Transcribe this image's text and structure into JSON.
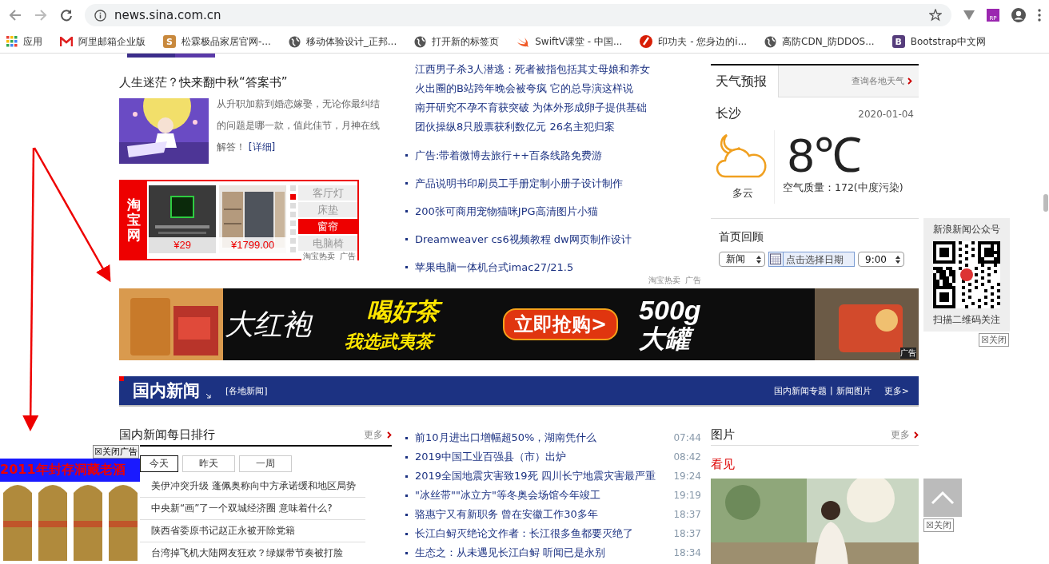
{
  "browser": {
    "url": "news.sina.com.cn",
    "extension_badge": "RP",
    "bookmarks": [
      {
        "label": "应用",
        "kind": "apps"
      },
      {
        "label": "阿里邮箱企业版",
        "kind": "mail"
      },
      {
        "label": "松霖极品家居官网-...",
        "kind": "letter",
        "glyph": "S"
      },
      {
        "label": "移动体验设计_正邦...",
        "kind": "globe"
      },
      {
        "label": "打开新的标签页",
        "kind": "globe"
      },
      {
        "label": "SwiftV课堂 - 中国...",
        "kind": "swift"
      },
      {
        "label": "印功夫 - 您身边的i...",
        "kind": "brush"
      },
      {
        "label": "高防CDN_防DDOS...",
        "kind": "globe"
      },
      {
        "label": "Bootstrap中文网",
        "kind": "letter",
        "glyph": "B"
      }
    ]
  },
  "feature": {
    "title": "人生迷茫？快来翻中秋“答案书”",
    "summary": "从升职加薪到婚恋嫁娶，无论你最纠结的问题是哪一款，值此佳节，月神在线解答！",
    "link": "[详细]"
  },
  "taobao_ad": {
    "logo": "淘宝网",
    "products": [
      {
        "kind": "course",
        "price": "¥29"
      },
      {
        "kind": "wardrobe",
        "price": "¥1799.00"
      }
    ],
    "dots": [
      {
        "selected": false
      },
      {
        "selected": true
      },
      {
        "selected": false
      },
      {
        "selected": false
      },
      {
        "selected": false
      },
      {
        "selected": false
      },
      {
        "selected": false
      },
      {
        "selected": false
      }
    ],
    "categories": [
      {
        "label": "客厅灯",
        "selected": false
      },
      {
        "label": "床垫",
        "selected": false
      },
      {
        "label": "窗帘",
        "selected": true
      },
      {
        "label": "电脑椅",
        "selected": false
      }
    ],
    "source": "淘宝热卖",
    "ad_tag": "广告"
  },
  "headlines": [
    "江西男子杀3人潜逃：死者被指包括其丈母娘和养女",
    "火出圈的B站跨年晚会被夸疯 它的总导演这样说",
    "南开研究不孕不育获突破 为体外形成卵子提供基础",
    "团伙操纵8只股票获利数亿元 26名主犯归案"
  ],
  "promo_links": [
    "广告:带着微博去旅行++百条线路免费游",
    "产品说明书印刷员工手册定制小册子设计制作",
    "200张可商用宠物猫咪JPG高清图片小猫",
    "Dreamweaver cs6视频教程 dw网页制作设计",
    "苹果电脑一体机台式imac27/21.5"
  ],
  "promo_source": "淘宝热卖",
  "promo_ad_tag": "广告",
  "weather": {
    "tab": "天气预报",
    "link": "查询各地天气",
    "city": "长沙",
    "date": "2020-01-04",
    "temperature": "8℃",
    "condition": "多云",
    "air_quality": "空气质量：172(中度污染)"
  },
  "review": {
    "title": "首页回顾",
    "channel": "新闻",
    "date_placeholder": "点击选择日期",
    "time": "9:00"
  },
  "banner": {
    "kind": "picture",
    "headline": "大红袍",
    "slogan_1": "喝好茶",
    "slogan_2": "我选武夷茶",
    "button": "立即抢购>",
    "weight": "500g",
    "size": "大罐",
    "ad_tag": "广告"
  },
  "section": {
    "title": "国内新闻",
    "sublink": "[各地新闻]",
    "links": [
      "国内新闻专题",
      "新闻图片"
    ],
    "separator": "|",
    "more": "更多>"
  },
  "ranking": {
    "title": "国内新闻每日排行",
    "more": "更多",
    "tabs": [
      {
        "label": "今天",
        "selected": true
      },
      {
        "label": "昨天",
        "selected": false
      },
      {
        "label": "一周",
        "selected": false
      }
    ],
    "items": [
      "美伊冲突升级 蓬佩奥称向中方承诺缓和地区局势",
      "中央新“画”了一个双城经济圈 意味着什么?",
      "陕西省委原书记赵正永被开除党籍",
      "台湾掉飞机大陆网友狂欢？绿媒带节奏被打脸"
    ]
  },
  "news": [
    {
      "title": "前10月进出口增幅超50%，湖南凭什么",
      "time": "07:44"
    },
    {
      "title": "2019中国工业百强县（市）出炉",
      "time": "08:42"
    },
    {
      "title": "2019全国地震灾害致19死 四川长宁地震灾害最严重",
      "time": "19:24"
    },
    {
      "title": "\"冰丝带\"\"冰立方\"等冬奥会场馆今年竣工",
      "time": "19:19"
    },
    {
      "title": "骆惠宁又有新职务 曾在安徽工作30多年",
      "time": "18:37"
    },
    {
      "title": "长江白鲟灭绝论文作者：长江很多鱼都要灭绝了",
      "time": "18:37"
    },
    {
      "title": "生态之：从未遇见长江白鲟 听闻已是永别",
      "time": "18:34"
    }
  ],
  "pictures": {
    "title": "图片",
    "more": "更多",
    "caption": "看见"
  },
  "qr_panel": {
    "title": "新浪新闻公众号",
    "caption": "扫描二维码关注",
    "close": "☒关闭"
  },
  "back_to_top": {
    "close": "☒关闭"
  },
  "floating_ad": {
    "headline": "2011年封存洞藏老酒",
    "close": "☒关闭广告"
  }
}
